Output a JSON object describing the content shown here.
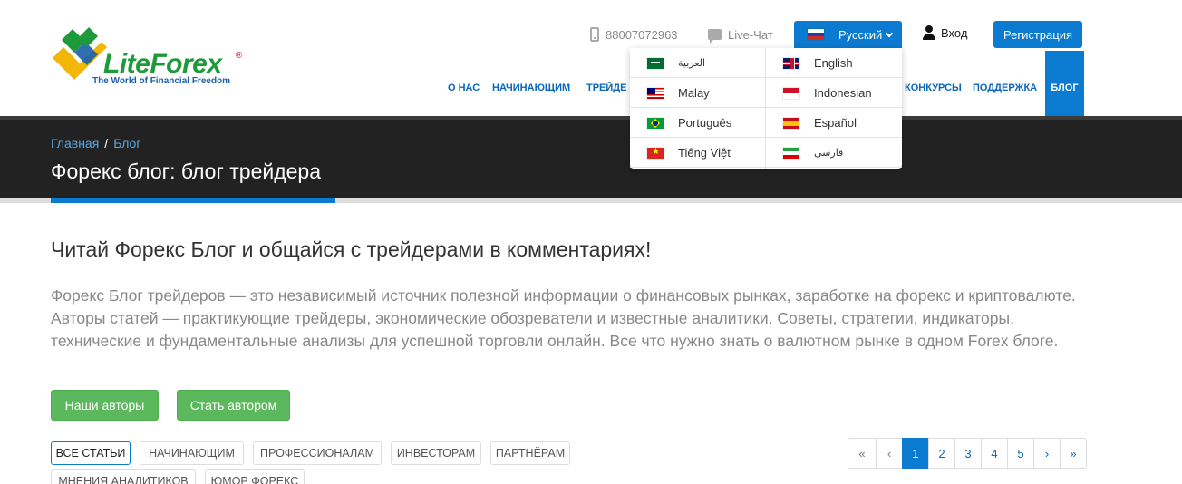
{
  "brand": {
    "name_part1": "Lite",
    "name_part2": "Forex",
    "registered": "®",
    "tagline": "The World of Financial Freedom"
  },
  "topbar": {
    "phone": "88007072963",
    "chat": "Live-Чат",
    "language": "Русский",
    "login": "Вход",
    "register": "Регистрация"
  },
  "nav": {
    "items": [
      "О НАС",
      "НАЧИНАЮЩИМ",
      "ТРЕЙДЕ",
      "КОНКУРСЫ",
      "ПОДДЕРЖКА",
      "БЛОГ"
    ],
    "active": "БЛОГ"
  },
  "languages": [
    {
      "label": "العربية",
      "flag": "sa"
    },
    {
      "label": "English",
      "flag": "gb"
    },
    {
      "label": "Malay",
      "flag": "my"
    },
    {
      "label": "Indonesian",
      "flag": "id"
    },
    {
      "label": "Português",
      "flag": "br"
    },
    {
      "label": "Español",
      "flag": "es"
    },
    {
      "label": "Tiếng Việt",
      "flag": "vn"
    },
    {
      "label": "فارسی",
      "flag": "ir"
    }
  ],
  "breadcrumb": {
    "home": "Главная",
    "separator": "/",
    "current": "Блог"
  },
  "page_title": "Форекс блог: блог трейдера",
  "headline": "Читай Форекс Блог и общайся с трейдерами в комментариях!",
  "intro": "Форекс Блог трейдеров — это независимый источник полезной информации о финансовых рынках, заработке на форекс и криптовалюте. Авторы статей — практикующие трейдеры, экономические обозреватели и известные аналитики. Советы, стратегии, индикаторы, технические и фундаментальные анализы для успешной торговли онлайн. Все что нужно знать о валютном рынке в одном Forex блоге.",
  "buttons": {
    "authors": "Наши авторы",
    "become_author": "Стать автором"
  },
  "tags": [
    "ВСЕ СТАТЬИ",
    "НАЧИНАЮЩИМ",
    "ПРОФЕССИОНАЛАМ",
    "ИНВЕСТОРАМ",
    "ПАРТНЁРАМ",
    "МНЕНИЯ АНАЛИТИКОВ",
    "ЮМОР ФОРЕКС"
  ],
  "active_tag": "ВСЕ СТАТЬИ",
  "pagination": {
    "first": "«",
    "prev": "‹",
    "pages": [
      "1",
      "2",
      "3",
      "4",
      "5"
    ],
    "current": "1",
    "next": "›",
    "last": "»"
  },
  "colors": {
    "brand_blue": "#0a7bd0",
    "banner_dark": "#222222",
    "button_green": "#5cb85c",
    "logo_green": "#1f9a3a"
  }
}
